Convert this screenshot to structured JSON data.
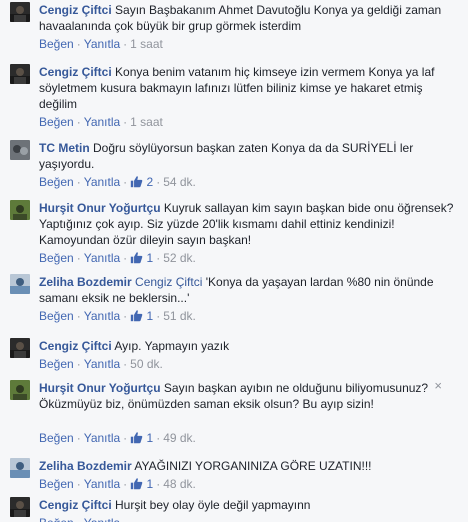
{
  "comments": [
    {
      "author": "Cengiz Çiftci",
      "mention": "",
      "text": "Sayın Başbakanım Ahmet Davutoğlu Konya ya geldiği zaman havaalanında çok büyük bir grup görmek isterdim",
      "like": "Beğen",
      "reply": "Yanıtla",
      "likes": "",
      "time": "1 saat",
      "avatar": "avatar-dark"
    },
    {
      "author": "Cengiz Çiftci",
      "mention": "",
      "text": "Konya benim vatanım hiç kimseye izin vermem Konya ya laf söyletmem kusura bakmayın lafınızı lütfen biliniz kimse ye hakaret etmiş değilim",
      "like": "Beğen",
      "reply": "Yanıtla",
      "likes": "",
      "time": "1 saat",
      "avatar": "avatar-dark"
    },
    {
      "author": "TC Metin",
      "mention": "",
      "text": "Doğru söylüyorsun başkan zaten Konya da da SURİYELİ ler yaşıyordu.",
      "like": "Beğen",
      "reply": "Yanıtla",
      "likes": "2",
      "time": "54 dk.",
      "avatar": "avatar-gray"
    },
    {
      "author": "Hurşit Onur Yoğurtçu",
      "mention": "",
      "text": "Kuyruk sallayan kim sayın başkan bide onu öğrensek? Yaptığınız çok ayıp. Siz yüzde 20'lik kısmamı dahil ettiniz kendinizi! Kamoyundan özür dileyin sayın başkan!",
      "like": "Beğen",
      "reply": "Yanıtla",
      "likes": "1",
      "time": "52 dk.",
      "avatar": "avatar-green"
    },
    {
      "author": "Zeliha Bozdemir",
      "mention": "Cengiz Çiftci",
      "text": "'Konya da yaşayan lardan %80 nin önünde samanı eksik ne beklersin...'",
      "like": "Beğen",
      "reply": "Yanıtla",
      "likes": "1",
      "time": "51 dk.",
      "avatar": "avatar-blue"
    },
    {
      "author": "Cengiz Çiftci",
      "mention": "",
      "text": "Ayıp. Yapmayın yazık",
      "like": "Beğen",
      "reply": "Yanıtla",
      "likes": "",
      "time": "50 dk.",
      "avatar": "avatar-dark"
    },
    {
      "author": "Hurşit Onur Yoğurtçu",
      "mention": "",
      "text": "Sayın başkan ayıbın ne olduğunu biliyomusunuz? Öküzmüyüz biz, önümüzden saman eksik olsun? Bu ayıp sizin!",
      "like": "Beğen",
      "reply": "Yanıtla",
      "likes": "1",
      "time": "49 dk.",
      "avatar": "avatar-green"
    },
    {
      "author": "Zeliha Bozdemir",
      "mention": "",
      "text": "AYAĞINIZI YORGANINIZA GÖRE UZATIN!!!",
      "like": "Beğen",
      "reply": "Yanıtla",
      "likes": "1",
      "time": "48 dk.",
      "avatar": "avatar-blue"
    },
    {
      "author": "Cengiz Çiftci",
      "mention": "",
      "text": "Hurşit bey olay öyle değil yapmayınn",
      "like": "Beğen",
      "reply": "Yanıtla",
      "likes": "",
      "time": "",
      "avatar": "avatar-dark"
    }
  ],
  "close_glyph": "×",
  "separator": "·",
  "colors": {
    "link": "#365899",
    "action": "#4267b2",
    "muted": "#90949c",
    "text": "#1d2129",
    "background": "#f6f7f9"
  }
}
